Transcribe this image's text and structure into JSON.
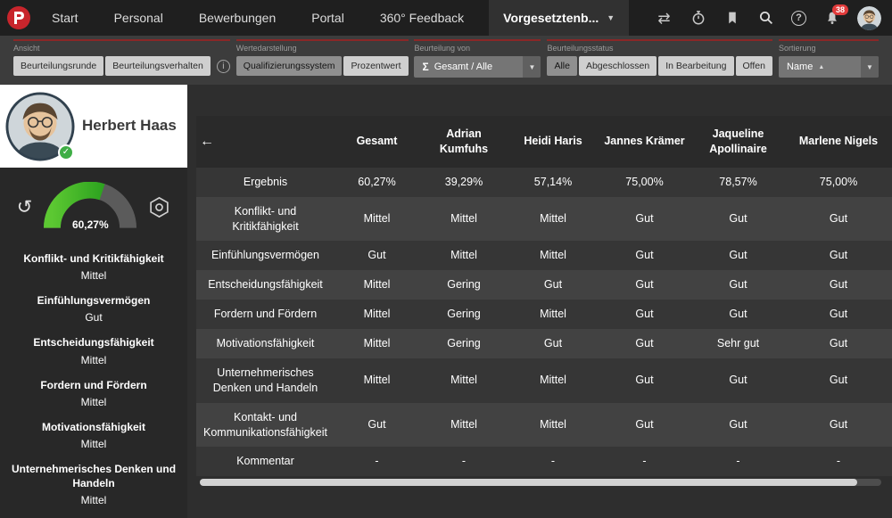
{
  "navbar": {
    "items": [
      "Start",
      "Personal",
      "Bewerbungen",
      "Portal",
      "360° Feedback"
    ],
    "active_item": "Vorgesetztenb...",
    "notification_count": "38"
  },
  "filters": {
    "ansicht": {
      "label": "Ansicht",
      "options": [
        "Beurteilungsrunde",
        "Beurteilungsverhalten"
      ]
    },
    "wertedarstellung": {
      "label": "Wertedarstellung",
      "options": [
        "Qualifizierungssystem",
        "Prozentwert"
      ],
      "selected": "Qualifizierungssystem"
    },
    "beurteilung_von": {
      "label": "Beurteilung von",
      "icon": "Σ",
      "selected": "Gesamt / Alle"
    },
    "beurteilungsstatus": {
      "label": "Beurteilungsstatus",
      "options": [
        "Alle",
        "Abgeschlossen",
        "In Bearbeitung",
        "Offen"
      ],
      "selected": "Alle"
    },
    "sortierung": {
      "label": "Sortierung",
      "selected": "Name",
      "direction": "asc"
    }
  },
  "profile": {
    "name": "Herbert Haas",
    "score": "60,27%",
    "score_percent": 60.27,
    "competencies": [
      {
        "label": "Konflikt- und Kritikfähigkeit",
        "value": "Mittel"
      },
      {
        "label": "Einfühlungsvermögen",
        "value": "Gut"
      },
      {
        "label": "Entscheidungsfähigkeit",
        "value": "Mittel"
      },
      {
        "label": "Fordern und Fördern",
        "value": "Mittel"
      },
      {
        "label": "Motivationsfähigkeit",
        "value": "Mittel"
      },
      {
        "label": "Unternehmerisches Denken und Handeln",
        "value": "Mittel"
      }
    ]
  },
  "table": {
    "columns": [
      "Gesamt",
      "Adrian Kumfuhs",
      "Heidi Haris",
      "Jannes Krämer",
      "Jaqueline Apollinaire",
      "Marlene Nigels"
    ],
    "rows": [
      {
        "label": "Ergebnis",
        "values": [
          "60,27%",
          "39,29%",
          "57,14%",
          "75,00%",
          "78,57%",
          "75,00%"
        ]
      },
      {
        "label": "Konflikt- und Kritikfähigkeit",
        "values": [
          "Mittel",
          "Mittel",
          "Mittel",
          "Gut",
          "Gut",
          "Gut"
        ]
      },
      {
        "label": "Einfühlungsvermögen",
        "values": [
          "Gut",
          "Mittel",
          "Mittel",
          "Gut",
          "Gut",
          "Gut"
        ]
      },
      {
        "label": "Entscheidungsfähigkeit",
        "values": [
          "Mittel",
          "Gering",
          "Gut",
          "Gut",
          "Gut",
          "Gut"
        ]
      },
      {
        "label": "Fordern und Fördern",
        "values": [
          "Mittel",
          "Gering",
          "Mittel",
          "Gut",
          "Gut",
          "Gut"
        ]
      },
      {
        "label": "Motivationsfähigkeit",
        "values": [
          "Mittel",
          "Gering",
          "Gut",
          "Gut",
          "Sehr gut",
          "Gut"
        ]
      },
      {
        "label": "Unternehmerisches Denken und Handeln",
        "values": [
          "Mittel",
          "Mittel",
          "Mittel",
          "Gut",
          "Gut",
          "Gut"
        ]
      },
      {
        "label": "Kontakt- und Kommunikationsfähigkeit",
        "values": [
          "Gut",
          "Mittel",
          "Mittel",
          "Gut",
          "Gut",
          "Gut"
        ]
      },
      {
        "label": "Kommentar",
        "values": [
          "-",
          "-",
          "-",
          "-",
          "-",
          "-"
        ]
      }
    ]
  },
  "icons": {
    "back_arrow": "←",
    "chevron_down": "▼",
    "sort_asc": "▲",
    "reset": "↺",
    "transfer": "⇄",
    "check": "✓",
    "info": "i",
    "help": "?"
  },
  "colors": {
    "accent_red": "#c8252c",
    "green": "#2fae2f",
    "status_active_gray": "#8f8f8f"
  }
}
